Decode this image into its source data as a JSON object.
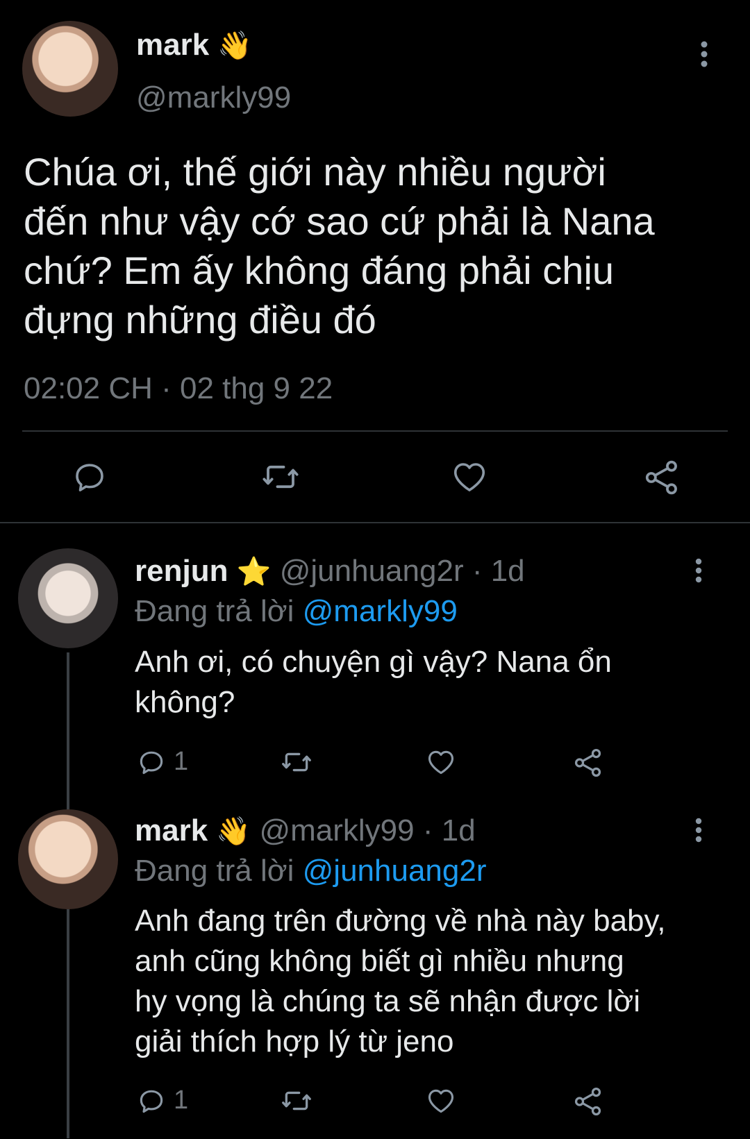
{
  "main_tweet": {
    "display_name": "mark",
    "name_emoji": "👋",
    "handle": "@markly99",
    "text_lines": [
      "Chúa ơi, thế giới này nhiều người",
      "đến như vậy cớ sao cứ phải là Nana",
      "chứ? Em ấy không đáng phải chịu",
      "đựng những điều đó"
    ],
    "timestamp": "02:02 CH · 02 thg 9 22",
    "icons": [
      "reply-icon",
      "retweet-icon",
      "like-icon",
      "share-icon"
    ]
  },
  "replies": [
    {
      "display_name": "renjun",
      "name_emoji": "⭐",
      "handle_time": "@junhuang2r · 1d",
      "replying_prefix": "Đang trả lời",
      "replying_to": "@markly99",
      "text_lines": [
        "Anh ơi, có chuyện gì vậy? Nana ổn",
        "không?"
      ],
      "reply_count": "1"
    },
    {
      "display_name": "mark",
      "name_emoji": "👋",
      "handle_time": "@markly99 · 1d",
      "replying_prefix": "Đang trả lời",
      "replying_to": "@junhuang2r",
      "text_lines": [
        "Anh đang trên đường về nhà này baby,",
        "anh cũng không biết gì nhiều nhưng",
        "hy vọng là chúng ta sẽ nhận được lời",
        "giải thích hợp lý từ jeno"
      ],
      "reply_count": "1"
    }
  ],
  "colors": {
    "background": "#000000",
    "text": "#e7e9ea",
    "muted": "#71767b",
    "link": "#1d9bf0",
    "icon": "#8b98a5"
  }
}
